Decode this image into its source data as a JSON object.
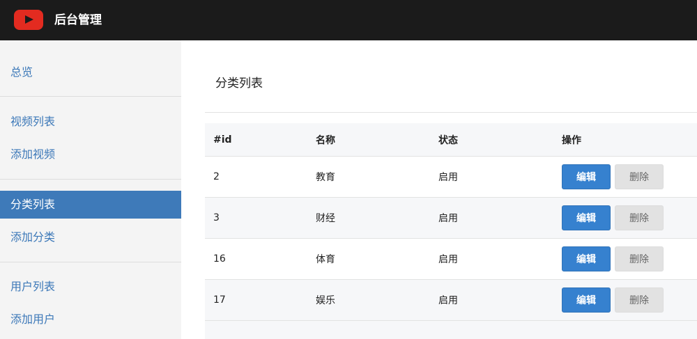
{
  "header": {
    "app_title": "后台管理",
    "logo_icon": "youtube-play-icon",
    "logo_color": "#e32b20"
  },
  "sidebar": {
    "items": [
      {
        "label": "总览"
      },
      {
        "label": "视频列表"
      },
      {
        "label": "添加视频"
      },
      {
        "label": "分类列表",
        "active": true
      },
      {
        "label": "添加分类"
      },
      {
        "label": "用户列表"
      },
      {
        "label": "添加用户"
      }
    ],
    "active_color": "#3e7ab9",
    "link_color": "#3c78b8"
  },
  "main": {
    "title": "分类列表",
    "table": {
      "columns": [
        "#id",
        "名称",
        "状态",
        "操作"
      ],
      "rows": [
        {
          "id": "2",
          "name": "教育",
          "status": "启用"
        },
        {
          "id": "3",
          "name": "财经",
          "status": "启用"
        },
        {
          "id": "16",
          "name": "体育",
          "status": "启用"
        },
        {
          "id": "17",
          "name": "娱乐",
          "status": "启用"
        }
      ],
      "edit_label": "编辑",
      "delete_label": "删除",
      "edit_color": "#3681cf"
    }
  }
}
